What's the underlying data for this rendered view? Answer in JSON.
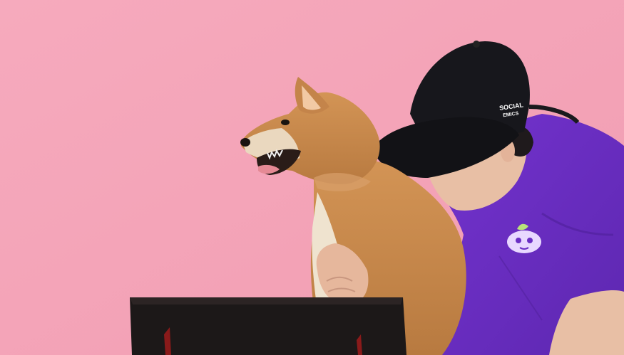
{
  "scene": {
    "background_color": "#f4a6b9",
    "shirt_color": "#6a2fc4",
    "cap_color": "#17171c",
    "dog_fur_color": "#c98a4b",
    "box_color": "#1c1818"
  },
  "cap": {
    "logo_line1": "SOCIAL",
    "logo_line2": "EMICS"
  }
}
